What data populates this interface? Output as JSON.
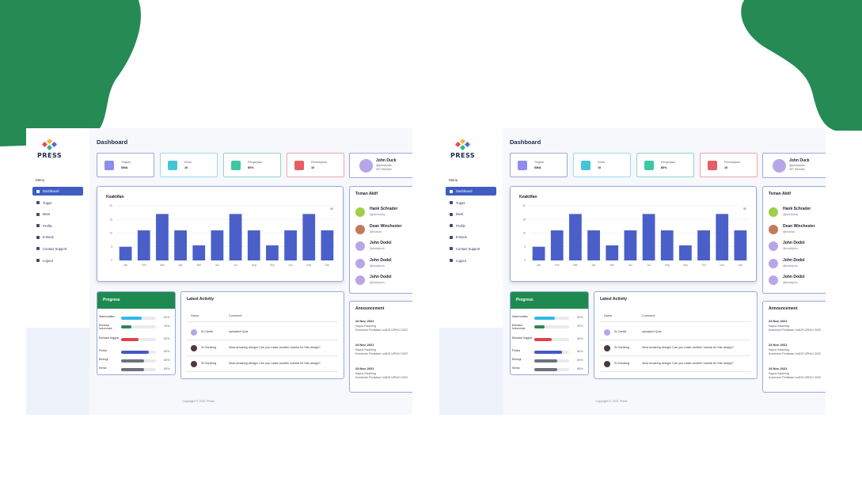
{
  "brand": {
    "name": "PRESS"
  },
  "colors": {
    "green_blob": "#268a55",
    "accent": "#3f5cc4",
    "progress_head": "#1e8a4f"
  },
  "menu_title": "Menu",
  "nav": [
    {
      "label": "Dashboard",
      "icon": "grid-icon",
      "active": true
    },
    {
      "label": "Tugas",
      "icon": "tasks-icon"
    },
    {
      "label": "Meet",
      "icon": "video-icon"
    },
    {
      "label": "Profile",
      "icon": "user-icon"
    },
    {
      "label": "E-Book",
      "icon": "book-icon"
    },
    {
      "label": "Contact Support",
      "icon": "phone-icon"
    },
    {
      "label": "Logout",
      "icon": "logout-icon"
    }
  ],
  "page_title": "Dashboard",
  "stats": [
    {
      "label": "Tingkat",
      "value": "SMA",
      "color": "#8e8cf0",
      "border": "#9aa8d8"
    },
    {
      "label": "Kelas",
      "value": "10",
      "color": "#45c4d8",
      "border": "#9fdbe6"
    },
    {
      "label": "Pengerjaan",
      "value": "80%",
      "color": "#3ec7a3",
      "border": "#8fd9c3"
    },
    {
      "label": "Pembayaran",
      "value": "10",
      "color": "#e85c66",
      "border": "#f0a6ab"
    }
  ],
  "profile": {
    "name": "John Duck",
    "handle": "@johnducks",
    "tier": "VIP Member"
  },
  "chart_data": {
    "type": "bar",
    "title": "Keaktifan",
    "legend": "50",
    "categories": [
      "Jan",
      "Feb",
      "Mar",
      "Apr",
      "Mei",
      "Jun",
      "Jul",
      "Aug",
      "Sep",
      "Oct",
      "Nov",
      "Dec"
    ],
    "values": [
      5,
      11,
      17,
      11,
      5.5,
      11,
      17,
      11,
      5.5,
      11,
      17,
      11
    ],
    "yticks": [
      0,
      5,
      10,
      15,
      20
    ],
    "ylim": [
      0,
      20
    ],
    "color": "#4a5fc8",
    "grid": true
  },
  "friends": {
    "title": "Teman Aktif",
    "items": [
      {
        "name": "Hank Schrader",
        "handle": "@johndunky",
        "color": "#9ed04a"
      },
      {
        "name": "Dean Winchester",
        "handle": "@imdean",
        "color": "#c27a5c"
      },
      {
        "name": "John Dodol",
        "handle": "@dodoljohn",
        "color": "#b7a6e8"
      },
      {
        "name": "John Dodol",
        "handle": "@dodoljohn",
        "color": "#b7a6e8"
      },
      {
        "name": "John Dodol",
        "handle": "@dodoljohn",
        "color": "#b7a6e8"
      }
    ]
  },
  "progress": {
    "title": "Progress",
    "items": [
      {
        "label": "Matematika",
        "pct": 60,
        "text": "60%",
        "color": "#34b8e6"
      },
      {
        "label": "Bahasa Indonesia",
        "pct": 30,
        "text": "30%",
        "color": "#2a8a4f"
      },
      {
        "label": "Bahasa Inggris",
        "pct": 50,
        "text": "50%",
        "color": "#e0414e"
      },
      {
        "label": "Fisika",
        "pct": 80,
        "text": "80%",
        "color": "#4458c4"
      },
      {
        "label": "Biologi",
        "pct": 65,
        "text": "65%",
        "color": "#6c7280"
      },
      {
        "label": "Kimia",
        "pct": 65,
        "text": "65%",
        "color": "#6c7280"
      }
    ]
  },
  "activity": {
    "title": "Latest Activity",
    "col_name": "Name",
    "col_comment": "Comment",
    "rows": [
      {
        "name": "Si Cantik",
        "comment": "uploaded Quiz",
        "color": "#b7a6e8"
      },
      {
        "name": "Si Ganteng",
        "comment": "Wow amazing design! Can you make another tutorial for this design?",
        "color": "#4a3a3a"
      },
      {
        "name": "Si Ganteng",
        "comment": "Wow amazing design! Can you make another tutorial for this design?",
        "color": "#4a3a3a"
      }
    ]
  },
  "announcement": {
    "title": "Announcement",
    "items": [
      {
        "date": "24 Nov, 2021",
        "lines": [
          "Kapus Kisaming",
          "Kuesioner Penilaian LeADS UPNVJ 2022"
        ]
      },
      {
        "date": "24 Nov, 2021",
        "lines": [
          "Kapus Kisaming",
          "Kuesioner Penilaian LeADS UPNVJ 2022"
        ]
      },
      {
        "date": "24 Nov, 2021",
        "lines": [
          "Kapus Kisaming",
          "Kuesioner Penilaian LeADS UPNVJ 2022"
        ]
      }
    ]
  },
  "copyright": "Copyright © 2021 Press"
}
